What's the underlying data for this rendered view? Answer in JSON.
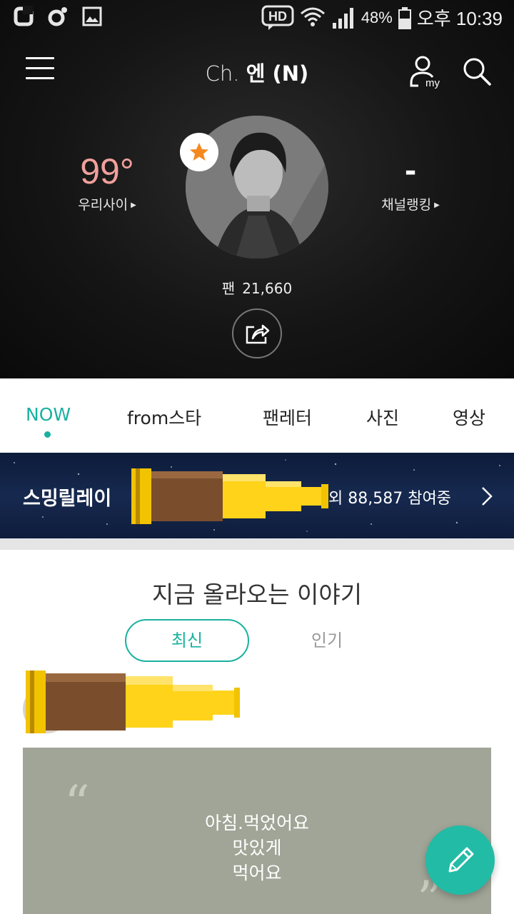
{
  "status_bar": {
    "icons_left": [
      "carrier-icon",
      "dot-ring-icon",
      "gallery-icon"
    ],
    "icons_right": [
      "hd-voice-icon",
      "wifi-icon",
      "signal-icon",
      "battery-icon"
    ],
    "battery": "48%",
    "time": "오후 10:39"
  },
  "header": {
    "channel_prefix": "Ch.",
    "channel_name": "엔 (N)",
    "menu_icon": "hamburger-menu-icon",
    "my_icon": "my-page-icon",
    "search_icon": "search-icon"
  },
  "profile": {
    "intimacy_value": "99°",
    "intimacy_label": "우리사이",
    "ranking_value": "-",
    "ranking_label": "채널랭킹",
    "fan_label": "팬",
    "fan_count": "21,660",
    "badge_icon": "star-icon",
    "share_icon": "share-icon"
  },
  "tabs": [
    {
      "label": "NOW",
      "active": true
    },
    {
      "label": "from스타",
      "active": false
    },
    {
      "label": "팬레터",
      "active": false
    },
    {
      "label": "사진",
      "active": false
    },
    {
      "label": "영상",
      "active": false
    }
  ],
  "relay": {
    "title": "스밍릴레이",
    "participants": "외 88,587 참여중"
  },
  "stories": {
    "title": "지금 올라오는 이야기",
    "filter_latest": "최신",
    "filter_popular": "인기",
    "card_lines": [
      "아침.먹었어요",
      "맛있게",
      "먹어요"
    ]
  },
  "colors": {
    "accent": "#19b1a0",
    "fab": "#22bba6",
    "intimacy": "#f0a09c",
    "card_bg": "#a1a597",
    "relay_bg": "#16294f"
  },
  "fab_icon": "pencil-icon"
}
